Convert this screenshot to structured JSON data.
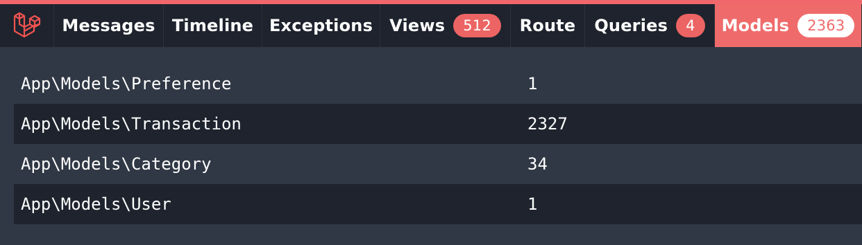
{
  "colors": {
    "accent": "#f0676c",
    "tabbar_bg": "#1e232d",
    "content_bg": "#303845"
  },
  "logo": {
    "icon": "laravel-logo-icon"
  },
  "tabs": [
    {
      "label": "Messages",
      "badge": null
    },
    {
      "label": "Timeline",
      "badge": null
    },
    {
      "label": "Exceptions",
      "badge": null
    },
    {
      "label": "Views",
      "badge": "512"
    },
    {
      "label": "Route",
      "badge": null
    },
    {
      "label": "Queries",
      "badge": "4"
    },
    {
      "label": "Models",
      "badge": "2363",
      "active": true
    }
  ],
  "models": {
    "rows": [
      {
        "name": "App\\Models\\Preference",
        "count": "1"
      },
      {
        "name": "App\\Models\\Transaction",
        "count": "2327"
      },
      {
        "name": "App\\Models\\Category",
        "count": "34"
      },
      {
        "name": "App\\Models\\User",
        "count": "1"
      }
    ]
  }
}
